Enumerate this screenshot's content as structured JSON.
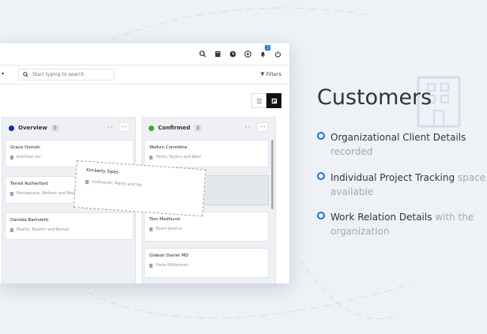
{
  "toolbar": {
    "icons": [
      "search-icon",
      "book-icon",
      "clock-icon",
      "plus-circle-icon",
      "bell-icon",
      "power-icon"
    ],
    "notification_count": "2"
  },
  "filterbar": {
    "search_placeholder": "Start typing to search",
    "filters_label": "Filters"
  },
  "board": {
    "columns": [
      {
        "title": "Overview",
        "count": "0",
        "color": "#1020d8",
        "cards": [
          {
            "name": "Grace Osinski",
            "company": "Kuhlman Inc"
          },
          {
            "name": "Terrell Rutherford",
            "company": "Romaguera, Wehner and Rodriguez"
          },
          {
            "name": "Daniela Bartoletti",
            "company": "Beatty, Boehm and Bernal"
          }
        ]
      },
      {
        "title": "Confirmed",
        "count": "0",
        "color": "#3aa832",
        "cards": [
          {
            "name": "Walton Considine",
            "company": "Hertz, Torphy and Beer"
          },
          {
            "name": "Tom Medhurst",
            "company": "Ebert-Jenkins"
          },
          {
            "name": "Gideon Daniel MD",
            "company": "Hane-Wilderman"
          }
        ]
      }
    ],
    "dragging_card": {
      "name": "Kimberly Sipes",
      "company": "Gutkowski, Marks and Fei"
    }
  },
  "panel": {
    "title": "Customers",
    "features": [
      {
        "main": "Organizational Client Details",
        "muted": "recorded"
      },
      {
        "main": "Individual Project Tracking",
        "muted": "space available"
      },
      {
        "main": "Work Relation Details",
        "muted": "with the organization"
      }
    ]
  },
  "colors": {
    "accent": "#1e6fe0",
    "background": "#eef1f6"
  }
}
